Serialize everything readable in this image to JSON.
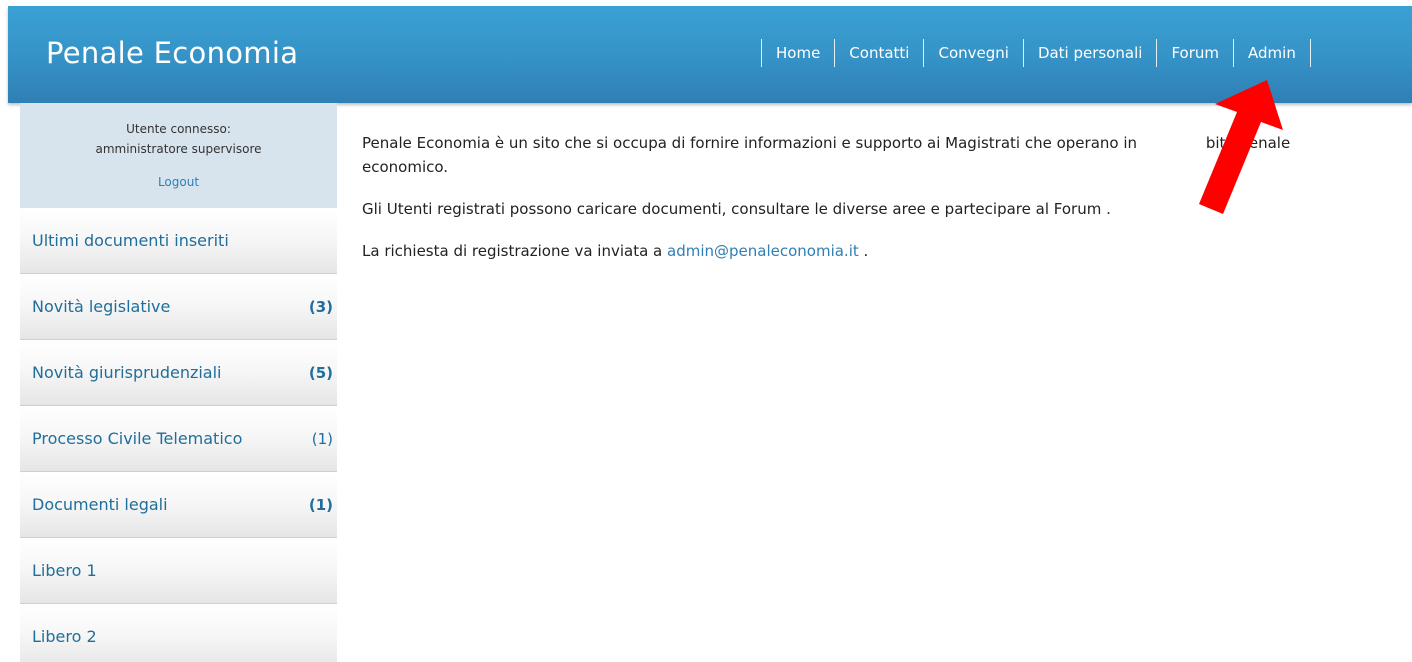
{
  "header": {
    "brand": "Penale Economia",
    "nav": [
      {
        "label": "Home"
      },
      {
        "label": "Contatti"
      },
      {
        "label": "Convegni"
      },
      {
        "label": "Dati personali"
      },
      {
        "label": "Forum"
      },
      {
        "label": "Admin"
      }
    ]
  },
  "sidebar": {
    "user_label": "Utente connesso:",
    "user_name": "amministratore supervisore",
    "logout": "Logout",
    "items": [
      {
        "label": "Ultimi documenti inseriti",
        "count": ""
      },
      {
        "label": "Novità legislative",
        "count": "(3)"
      },
      {
        "label": "Novità giurisprudenziali",
        "count": "(5)"
      },
      {
        "label": "Processo Civile Telematico",
        "count": "(1)"
      },
      {
        "label": "Documenti legali",
        "count": "(1)"
      },
      {
        "label": "Libero 1",
        "count": ""
      },
      {
        "label": "Libero 2",
        "count": ""
      }
    ]
  },
  "main": {
    "p1a": "Penale Economia è un sito che si occupa di fornire informazioni e supporto ai Magistrati che operano in",
    "p1b": "bito penale",
    "p1c": "economico.",
    "p2": "Gli Utenti registrati possono caricare documenti, consultare le diverse aree e partecipare al Forum .",
    "p3_prefix": "La richiesta di registrazione va inviata a ",
    "p3_link": "admin@penaleconomia.it",
    "p3_suffix": " ."
  },
  "colors": {
    "header": "#3592c6",
    "link": "#2f7fb4",
    "annotation_arrow": "#ff0000"
  },
  "annotation": {
    "icon": "red-arrow-icon",
    "points_to": "Forum"
  }
}
